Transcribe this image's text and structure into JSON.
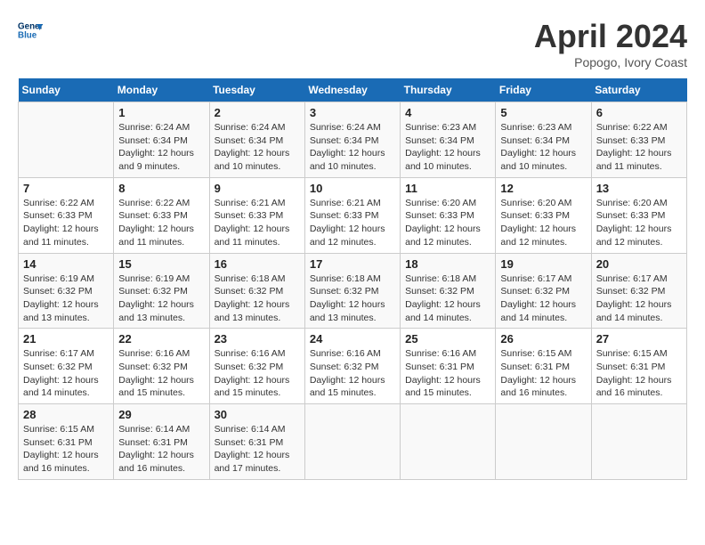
{
  "header": {
    "logo_line1": "General",
    "logo_line2": "Blue",
    "month": "April 2024",
    "location": "Popogo, Ivory Coast"
  },
  "days_of_week": [
    "Sunday",
    "Monday",
    "Tuesday",
    "Wednesday",
    "Thursday",
    "Friday",
    "Saturday"
  ],
  "weeks": [
    [
      {
        "day": "",
        "info": ""
      },
      {
        "day": "1",
        "info": "Sunrise: 6:24 AM\nSunset: 6:34 PM\nDaylight: 12 hours\nand 9 minutes."
      },
      {
        "day": "2",
        "info": "Sunrise: 6:24 AM\nSunset: 6:34 PM\nDaylight: 12 hours\nand 10 minutes."
      },
      {
        "day": "3",
        "info": "Sunrise: 6:24 AM\nSunset: 6:34 PM\nDaylight: 12 hours\nand 10 minutes."
      },
      {
        "day": "4",
        "info": "Sunrise: 6:23 AM\nSunset: 6:34 PM\nDaylight: 12 hours\nand 10 minutes."
      },
      {
        "day": "5",
        "info": "Sunrise: 6:23 AM\nSunset: 6:34 PM\nDaylight: 12 hours\nand 10 minutes."
      },
      {
        "day": "6",
        "info": "Sunrise: 6:22 AM\nSunset: 6:33 PM\nDaylight: 12 hours\nand 11 minutes."
      }
    ],
    [
      {
        "day": "7",
        "info": "Sunrise: 6:22 AM\nSunset: 6:33 PM\nDaylight: 12 hours\nand 11 minutes."
      },
      {
        "day": "8",
        "info": "Sunrise: 6:22 AM\nSunset: 6:33 PM\nDaylight: 12 hours\nand 11 minutes."
      },
      {
        "day": "9",
        "info": "Sunrise: 6:21 AM\nSunset: 6:33 PM\nDaylight: 12 hours\nand 11 minutes."
      },
      {
        "day": "10",
        "info": "Sunrise: 6:21 AM\nSunset: 6:33 PM\nDaylight: 12 hours\nand 12 minutes."
      },
      {
        "day": "11",
        "info": "Sunrise: 6:20 AM\nSunset: 6:33 PM\nDaylight: 12 hours\nand 12 minutes."
      },
      {
        "day": "12",
        "info": "Sunrise: 6:20 AM\nSunset: 6:33 PM\nDaylight: 12 hours\nand 12 minutes."
      },
      {
        "day": "13",
        "info": "Sunrise: 6:20 AM\nSunset: 6:33 PM\nDaylight: 12 hours\nand 12 minutes."
      }
    ],
    [
      {
        "day": "14",
        "info": "Sunrise: 6:19 AM\nSunset: 6:32 PM\nDaylight: 12 hours\nand 13 minutes."
      },
      {
        "day": "15",
        "info": "Sunrise: 6:19 AM\nSunset: 6:32 PM\nDaylight: 12 hours\nand 13 minutes."
      },
      {
        "day": "16",
        "info": "Sunrise: 6:18 AM\nSunset: 6:32 PM\nDaylight: 12 hours\nand 13 minutes."
      },
      {
        "day": "17",
        "info": "Sunrise: 6:18 AM\nSunset: 6:32 PM\nDaylight: 12 hours\nand 13 minutes."
      },
      {
        "day": "18",
        "info": "Sunrise: 6:18 AM\nSunset: 6:32 PM\nDaylight: 12 hours\nand 14 minutes."
      },
      {
        "day": "19",
        "info": "Sunrise: 6:17 AM\nSunset: 6:32 PM\nDaylight: 12 hours\nand 14 minutes."
      },
      {
        "day": "20",
        "info": "Sunrise: 6:17 AM\nSunset: 6:32 PM\nDaylight: 12 hours\nand 14 minutes."
      }
    ],
    [
      {
        "day": "21",
        "info": "Sunrise: 6:17 AM\nSunset: 6:32 PM\nDaylight: 12 hours\nand 14 minutes."
      },
      {
        "day": "22",
        "info": "Sunrise: 6:16 AM\nSunset: 6:32 PM\nDaylight: 12 hours\nand 15 minutes."
      },
      {
        "day": "23",
        "info": "Sunrise: 6:16 AM\nSunset: 6:32 PM\nDaylight: 12 hours\nand 15 minutes."
      },
      {
        "day": "24",
        "info": "Sunrise: 6:16 AM\nSunset: 6:32 PM\nDaylight: 12 hours\nand 15 minutes."
      },
      {
        "day": "25",
        "info": "Sunrise: 6:16 AM\nSunset: 6:31 PM\nDaylight: 12 hours\nand 15 minutes."
      },
      {
        "day": "26",
        "info": "Sunrise: 6:15 AM\nSunset: 6:31 PM\nDaylight: 12 hours\nand 16 minutes."
      },
      {
        "day": "27",
        "info": "Sunrise: 6:15 AM\nSunset: 6:31 PM\nDaylight: 12 hours\nand 16 minutes."
      }
    ],
    [
      {
        "day": "28",
        "info": "Sunrise: 6:15 AM\nSunset: 6:31 PM\nDaylight: 12 hours\nand 16 minutes."
      },
      {
        "day": "29",
        "info": "Sunrise: 6:14 AM\nSunset: 6:31 PM\nDaylight: 12 hours\nand 16 minutes."
      },
      {
        "day": "30",
        "info": "Sunrise: 6:14 AM\nSunset: 6:31 PM\nDaylight: 12 hours\nand 17 minutes."
      },
      {
        "day": "",
        "info": ""
      },
      {
        "day": "",
        "info": ""
      },
      {
        "day": "",
        "info": ""
      },
      {
        "day": "",
        "info": ""
      }
    ]
  ]
}
